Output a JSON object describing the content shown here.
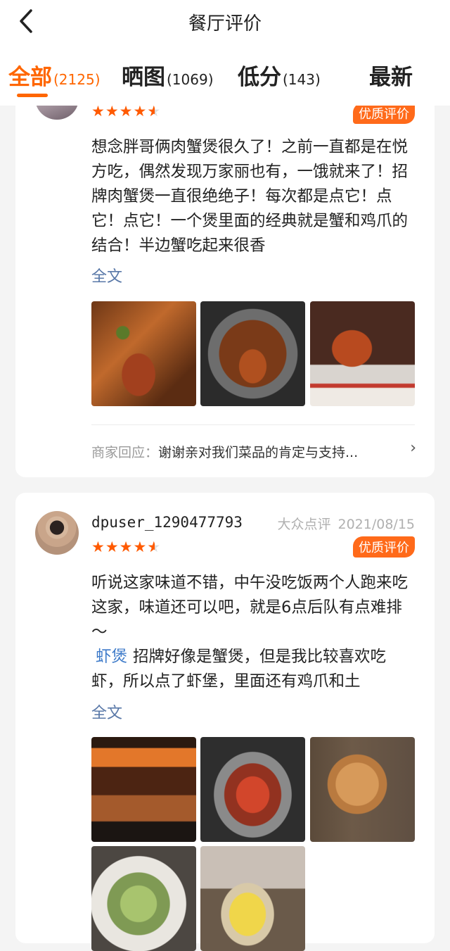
{
  "header": {
    "title": "餐厅评价",
    "tabs": [
      {
        "label": "全部",
        "count": "(2125)"
      },
      {
        "label": "晒图",
        "count": "(1069)"
      },
      {
        "label": "低分",
        "count": "(143)"
      },
      {
        "label": "最新",
        "count": ""
      }
    ]
  },
  "reviews": [
    {
      "rating": 4.5,
      "badge": "优质评价",
      "text": "想念胖哥俩肉蟹煲很久了！之前一直都是在悦方吃，偶然发现万家丽也有，一饿就来了！招牌肉蟹煲一直很绝绝子！每次都是点它！点它！点它！一个煲里面的经典就是蟹和鸡爪的结合！半边蟹吃起来很香",
      "more_label": "全文",
      "reply_label": "商家回应：",
      "reply_text": "谢谢亲对我们菜品的肯定与支持..."
    },
    {
      "username": "dpuser_1290477793",
      "source": "大众点评",
      "date": "2021/08/15",
      "rating": 4.5,
      "badge": "优质评价",
      "text": "听说这家味道不错，中午没吃饭两个人跑来吃这家，味道还可以吧，就是6点后队有点难排～",
      "tag": "虾煲",
      "text2": "招牌好像是蟹煲，但是我比较喜欢吃虾，所以点了虾堡，里面还有鸡爪和土",
      "more_label": "全文"
    }
  ],
  "colors": {
    "accent": "#ff6600",
    "badge": "#ff6a1a",
    "link": "#5978a8",
    "tag": "#3d7ac9"
  }
}
